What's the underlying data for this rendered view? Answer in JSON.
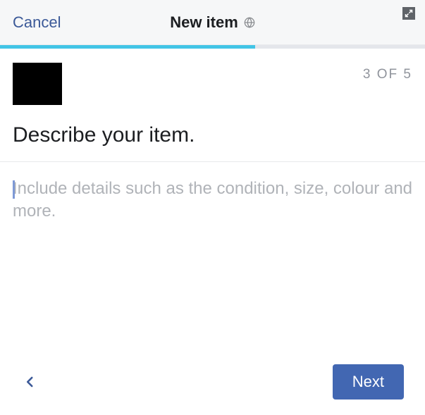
{
  "header": {
    "cancel_label": "Cancel",
    "title": "New item",
    "privacy_icon": "globe-icon",
    "expand_icon": "expand-icon"
  },
  "progress": {
    "current": 3,
    "total": 5,
    "percent": 60,
    "label": "3 OF 5",
    "fill_color": "#42c5e6"
  },
  "thumbnail": {
    "src": null
  },
  "prompt": {
    "heading": "Describe your item."
  },
  "description": {
    "value": "",
    "placeholder": "Include details such as the condition, size, colour and more."
  },
  "footer": {
    "back_icon": "chevron-left-icon",
    "next_label": "Next"
  },
  "colors": {
    "accent": "#3b5998",
    "primary_button": "#4267b2",
    "progress": "#42c5e6"
  }
}
